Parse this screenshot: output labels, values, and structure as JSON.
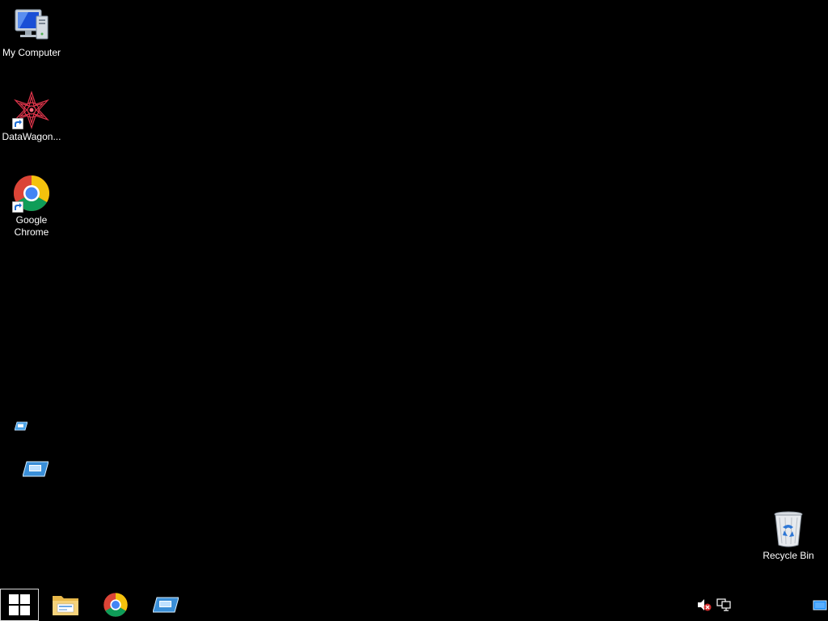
{
  "desktop": {
    "icons": {
      "my_computer": {
        "label": "My Computer",
        "icon": "my-computer-icon"
      },
      "datawagon": {
        "label": "DataWagon...",
        "icon": "datawagon-icon"
      },
      "chrome": {
        "label": "Google Chrome",
        "icon": "chrome-icon"
      },
      "recycle_bin": {
        "label": "Recycle Bin",
        "icon": "recycle-bin-icon"
      }
    },
    "unlabeled_shortcuts": [
      "remote-desktop-icon",
      "remote-desktop-icon"
    ],
    "background_color": "#000000"
  },
  "taskbar": {
    "start": {
      "icon": "windows-logo-icon"
    },
    "pinned": [
      "file-explorer-icon",
      "chrome-icon",
      "remote-desktop-icon"
    ],
    "tray": [
      "volume-muted-icon",
      "network-icon",
      "show-desktop-icon"
    ]
  },
  "colors": {
    "accent_blue": "#1e90ff",
    "chrome_red": "#db4437",
    "chrome_yellow": "#f4c20d",
    "chrome_green": "#0f9d58",
    "chrome_blue": "#4285f4"
  }
}
